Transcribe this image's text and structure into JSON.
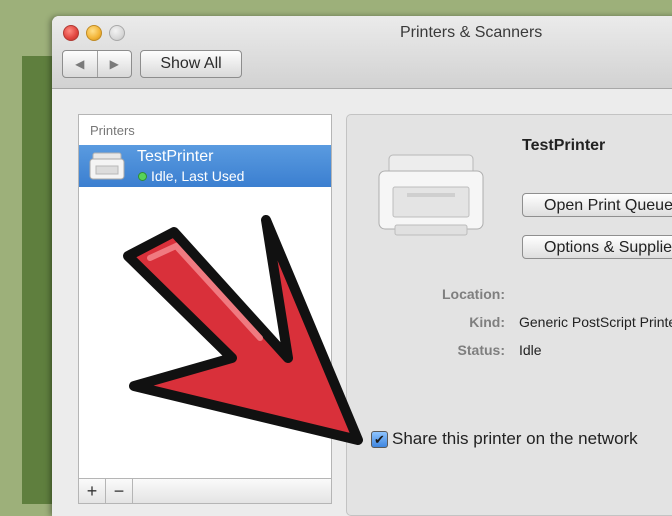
{
  "window": {
    "title": "Printers & Scanners",
    "nav": {
      "back_icon": "chevron-left-icon",
      "forward_icon": "chevron-right-icon"
    },
    "show_all_label": "Show All"
  },
  "printers_list": {
    "header": "Printers",
    "items": [
      {
        "name": "TestPrinter",
        "status": "Idle, Last Used",
        "status_color": "#57d35a"
      }
    ],
    "add_label": "+",
    "remove_label": "−"
  },
  "detail": {
    "printer_name": "TestPrinter",
    "open_queue_label": "Open Print Queue...",
    "options_label": "Options & Supplies...",
    "fields": [
      {
        "label": "Location:",
        "value": ""
      },
      {
        "label": "Kind:",
        "value": "Generic PostScript Printer"
      },
      {
        "label": "Status:",
        "value": "Idle"
      }
    ],
    "share_label": "Share this printer on the network",
    "share_checked": true
  },
  "colors": {
    "selection": "#3f86de",
    "arrow": "#d9303a",
    "background": "#9db07a"
  }
}
